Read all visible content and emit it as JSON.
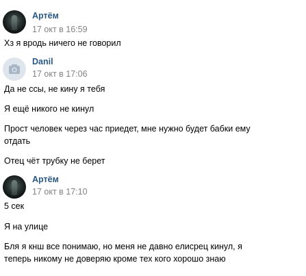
{
  "messages": [
    {
      "author": "Артём",
      "time": "17 окт в 16:59",
      "avatar": "dark-photo",
      "lines": [
        "Хз я вродь ничего не говорил"
      ]
    },
    {
      "author": "Danil",
      "time": "17 окт в 17:06",
      "avatar": "camera-icon",
      "lines": [
        "Да не ссы, не кину я тебя",
        "Я ещё никого не кинул",
        "Прост человек через час приедет, мне нужно будет бабки ему отдать",
        "Отец чёт трубку не берет"
      ]
    },
    {
      "author": "Артём",
      "time": "17 окт в 17:10",
      "avatar": "dark-photo",
      "lines": [
        "5 сек",
        "Я на улице",
        "Бля я кнш все понимаю, но меня не давно елисрец кинул, я теперь никому не доверяю кроме тех кого хорошо знаю"
      ]
    }
  ],
  "colors": {
    "author": "#2a5885",
    "time": "#828282",
    "text": "#000000",
    "camera_avatar_bg": "#dfe5ec",
    "camera_icon": "#a8b6c6"
  }
}
